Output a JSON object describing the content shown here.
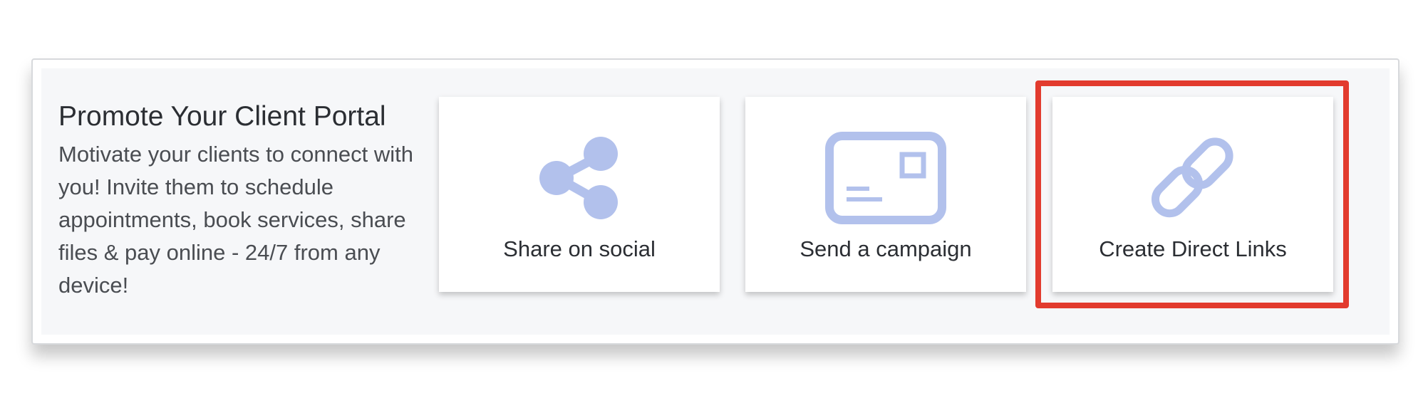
{
  "promo": {
    "title": "Promote Your Client Portal",
    "body": "Motivate your clients to connect with you! Invite them to schedule appointments, book services, share files & pay online - 24/7 from any device!"
  },
  "cards": [
    {
      "label": "Share on social",
      "icon": "share-icon"
    },
    {
      "label": "Send a campaign",
      "icon": "envelope-icon"
    },
    {
      "label": "Create Direct Links",
      "icon": "link-icon"
    }
  ],
  "colors": {
    "icon": "#b2c1ec",
    "highlight": "#e23b2e",
    "panel": "#f6f7f9"
  }
}
